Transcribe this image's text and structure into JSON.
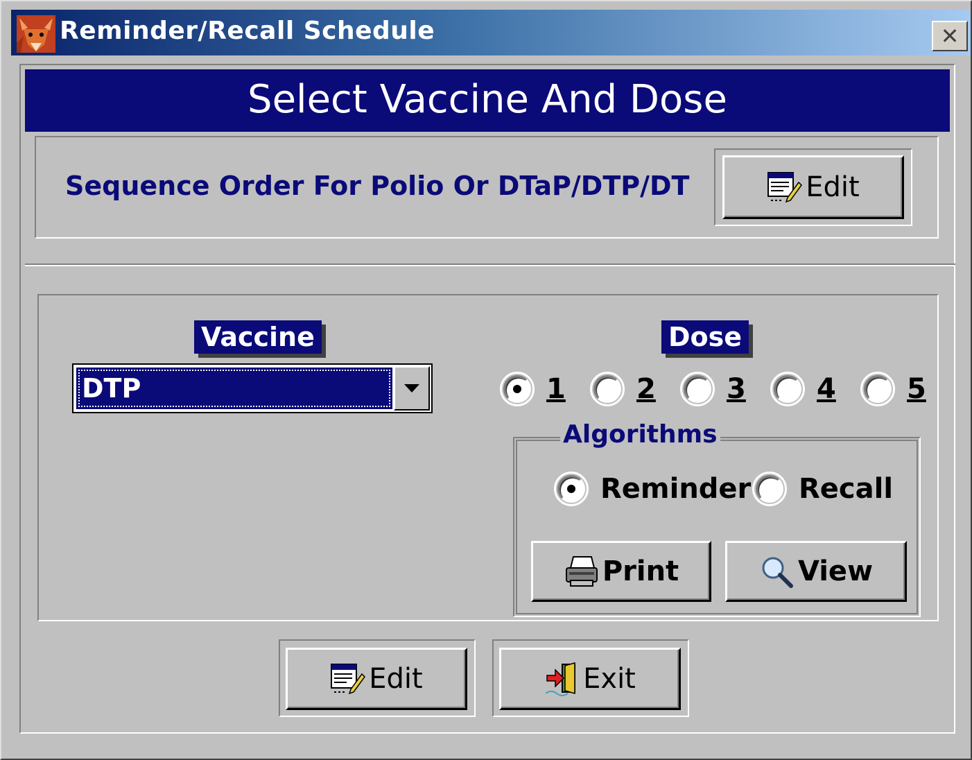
{
  "window": {
    "title": "Reminder/Recall Schedule",
    "app_icon": "fox-icon",
    "close_glyph": "✕"
  },
  "heading": "Select Vaccine And Dose",
  "sequence": {
    "label": "Sequence Order For Polio Or DTaP/DTP/DT",
    "edit_label": "Edit"
  },
  "vaccine": {
    "label": "Vaccine",
    "selected": "DTP"
  },
  "dose": {
    "label": "Dose",
    "options": [
      "1",
      "2",
      "3",
      "4",
      "5"
    ],
    "selected": "1"
  },
  "algorithms": {
    "label": "Algorithms",
    "reminder_label": "Reminder",
    "recall_label": "Recall",
    "selected": "Reminder",
    "print_label": "Print",
    "view_label": "View"
  },
  "footer": {
    "edit_label": "Edit",
    "exit_label": "Exit"
  },
  "colors": {
    "title_gradient_start": "#0a246a",
    "title_gradient_end": "#a6caf0",
    "heading_bg": "#0a0a78",
    "face": "#c0c0c0"
  }
}
